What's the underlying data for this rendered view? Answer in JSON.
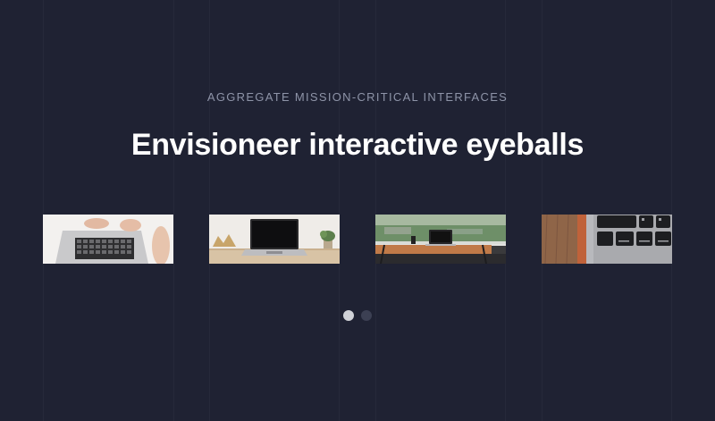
{
  "hero": {
    "eyebrow": "AGGREGATE MISSION-CRITICAL INTERFACES",
    "title": "Envisioneer interactive eyeballs"
  },
  "carousel": {
    "slides": [
      {
        "icon": "laptop-typing-photo"
      },
      {
        "icon": "laptop-desk-photo"
      },
      {
        "icon": "laptop-window-view-photo"
      },
      {
        "icon": "keyboard-closeup-photo"
      }
    ],
    "active_index": 0,
    "page_count": 2
  },
  "colors": {
    "background": "#1f2233",
    "dot_active": "#d0d2d8",
    "dot_inactive": "#3c4053"
  }
}
